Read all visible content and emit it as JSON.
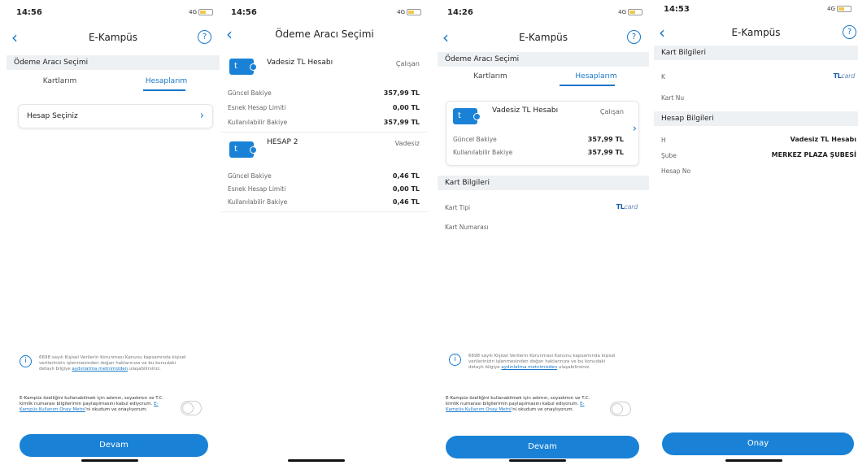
{
  "screens": [
    {
      "time": "14:56",
      "network": "4G",
      "title": "E-Kampüs",
      "help": "?",
      "back": "‹",
      "section": "Ödeme Aracı Seçimi",
      "tabs": [
        "Kartlarım",
        "Hesaplarım"
      ],
      "active_tab": 1,
      "select_label": "Hesap Seçiniz",
      "kvkk_text": "6698 sayılı Kişisel Verilerin Korunması Kanunu kapsamında kişisel verilerinizin işlenmesinden doğan haklarınıza ve bu konudaki detaylı bilgiye ",
      "kvkk_link": "aydınlatma metnimizden",
      "kvkk_tail": " ulaşabilirsiniz.",
      "consent_text": "E-Kampüs özelliğini kullanabilmek için adımın, soyadımın ve T.C. kimlik numarası bilgilerimin paylaşılmasını kabul ediyorum. ",
      "consent_link": "E-Kampüs Kullanım Onay Metni",
      "consent_tail": "'ni okudum ve onaylıyorum.",
      "button": "Devam"
    },
    {
      "time": "14:56",
      "network": "4G",
      "title": "Ödeme Aracı Seçimi",
      "back": "‹",
      "accounts": [
        {
          "icon": "t",
          "name": "Vadesiz TL Hesabı",
          "type": "Çalışan",
          "rows": [
            {
              "label": "Güncel Bakiye",
              "value": "357,99 TL"
            },
            {
              "label": "Esnek Hesap Limiti",
              "value": "0,00 TL"
            },
            {
              "label": "Kullanılabilir Bakiye",
              "value": "357,99 TL"
            }
          ]
        },
        {
          "icon": "t",
          "name": "HESAP 2",
          "type": "Vadesiz",
          "rows": [
            {
              "label": "Güncel Bakiye",
              "value": "0,46 TL"
            },
            {
              "label": "Esnek Hesap Limiti",
              "value": "0,00 TL"
            },
            {
              "label": "Kullanılabilir Bakiye",
              "value": "0,46 TL"
            }
          ]
        }
      ]
    },
    {
      "time": "14:26",
      "network": "4G",
      "title": "E-Kampüs",
      "help": "?",
      "back": "‹",
      "section": "Ödeme Aracı Seçimi",
      "tabs": [
        "Kartlarım",
        "Hesaplarım"
      ],
      "active_tab": 1,
      "card": {
        "icon": "t",
        "name": "Vadesiz TL Hesabı",
        "type": "Çalışan",
        "rows": [
          {
            "label": "Güncel Bakiye",
            "value": "357,99 TL"
          },
          {
            "label": "Kullanılabilir Bakiye",
            "value": "357,99 TL"
          }
        ]
      },
      "card_info_head": "Kart Bilgileri",
      "card_type_label": "Kart Tipi",
      "card_type_value_bold": "TL",
      "card_type_value_rest": "card",
      "card_number_label": "Kart Numarası",
      "kvkk_text": "6698 sayılı Kişisel Verilerin Korunması Kanunu kapsamında kişisel verilerinizin işlenmesinden doğan haklarınıza ve bu konudaki detaylı bilgiye ",
      "kvkk_link": "aydınlatma metnimizden",
      "kvkk_tail": " ulaşabilirsiniz.",
      "consent_text": "E-Kampüs özelliğini kullanabilmek için adımın, soyadımın ve T.C. kimlik numarası bilgilerimin paylaşılmasını kabul ediyorum. ",
      "consent_link": "E-Kampüs Kullanım Onay Metni",
      "consent_tail": "'ni okudum ve onaylıyorum.",
      "button": "Devam"
    },
    {
      "time": "14:53",
      "network": "4G",
      "title": "E-Kampüs",
      "help": "?",
      "back": "‹",
      "card_info_head": "Kart Bilgileri",
      "card_type_label": "K",
      "card_type_value_bold": "TL",
      "card_type_value_rest": "card",
      "card_number_label": "Kart Nu",
      "account_info_head": "Hesap Bilgileri",
      "account_label": "H",
      "account_value": "Vadesiz TL Hesabı",
      "branch_label": "Şube",
      "branch_value": "MERKEZ PLAZA ŞUBESİ",
      "account_no_label": "Hesap No",
      "button": "Onay"
    }
  ],
  "colors": {
    "accent": "#1a82d6",
    "link": "#1877c9",
    "section_bg": "#eef1f4"
  }
}
